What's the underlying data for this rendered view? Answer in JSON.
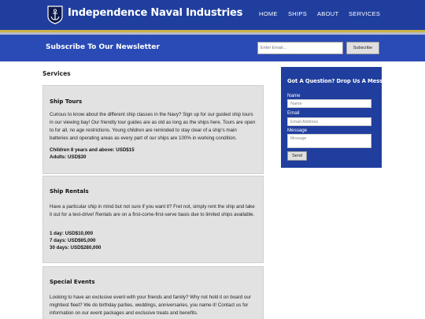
{
  "header": {
    "brand": "Independence Naval Industries",
    "nav": [
      {
        "label": "HOME"
      },
      {
        "label": "SHIPS"
      },
      {
        "label": "ABOUT"
      },
      {
        "label": "SERVICES"
      }
    ],
    "colors": {
      "bar": "#1f3e9e",
      "accent_line": "#c9b24a",
      "gray_line": "#b9bcc4"
    }
  },
  "newsletter": {
    "title": "Subscribe To Our Newsletter",
    "email_placeholder": "Enter Email...",
    "button_label": "Subscribe",
    "color": "#2a4bb5"
  },
  "main": {
    "heading": "Services",
    "cards": [
      {
        "title": "Ship Tours",
        "description": "Curious to know about the different ship classes in the Navy? Sign up for our guided ship tours in our viewing bay! Our friendly tour guides are as old as long as the ships here. Tours are open to for all, no age restrictions. Young children are reminded to stay clear of a ship's main batteries and operating areas as every part of our ships are 100% in working condition.",
        "prices": [
          "Children 8 years and above: USD$15",
          "Adults: USD$30"
        ]
      },
      {
        "title": "Ship Rentals",
        "description": "Have a particular ship in mind but not sure if you want it? Fret not, simply rent the ship and take it out for a test-drive! Rentals are on a first-come-first-serve basis due to limited ships available.",
        "prices": [
          "1 day: USD$10,000",
          "7 days: USD$65,000",
          "30 days: USD$280,000"
        ]
      },
      {
        "title": "Special Events",
        "description": "Looking to have an exclusive event with your friends and family? Why not hold it on board our mightiest fleet? We do birthday parties, weddings, anniversaries, you name it! Contact us for information on our event packages and exclusive treats and benefits.",
        "prices": []
      }
    ]
  },
  "contact": {
    "title": "Got A Question? Drop Us A Message!",
    "name_label": "Name",
    "name_placeholder": "Name",
    "email_label": "Email",
    "email_placeholder": "Email Address",
    "message_label": "Message",
    "message_placeholder": "Message",
    "send_label": "Send",
    "color": "#1f3e9e"
  }
}
